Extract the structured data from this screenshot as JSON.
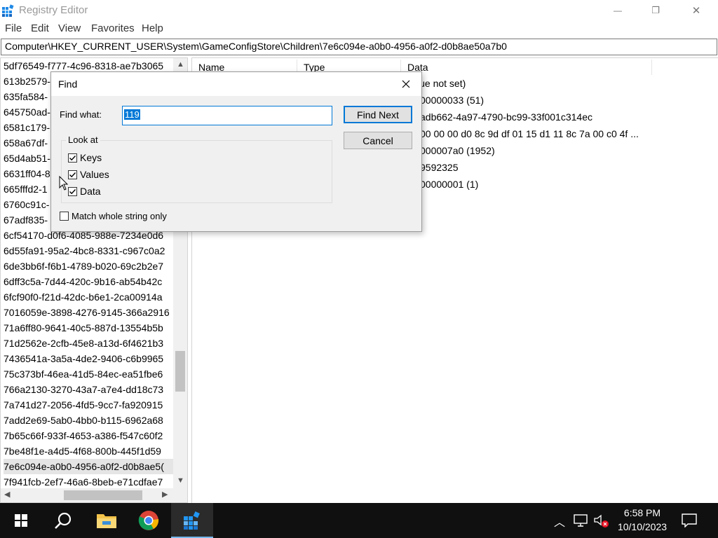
{
  "window": {
    "title": "Registry Editor",
    "minimize_glyph": "—",
    "restore_glyph": "❐",
    "close_glyph": "✕"
  },
  "menu": [
    "File",
    "Edit",
    "View",
    "Favorites",
    "Help"
  ],
  "address": "Computer\\HKEY_CURRENT_USER\\System\\GameConfigStore\\Children\\7e6c094e-a0b0-4956-a0f2-d0b8ae50a7b0",
  "tree": {
    "items": [
      "5df76549-f777-4c96-8318-ae7b3065",
      "613b2579-",
      "635fa584-",
      "645750ad-",
      "6581c179-",
      "658a67df-",
      "65d4ab51-",
      "6631ff04-8",
      "665fffd2-1",
      "6760c91c-",
      "67adf835-",
      "6cf54170-d0f6-4085-988e-7234e0d6",
      "6d55fa91-95a2-4bc8-8331-c967c0a2",
      "6de3bb6f-f6b1-4789-b020-69c2b2e7",
      "6dff3c5a-7d44-420c-9b16-ab54b42c",
      "6fcf90f0-f21d-42dc-b6e1-2ca00914a",
      "7016059e-3898-4276-9145-366a2916",
      "71a6ff80-9641-40c5-887d-13554b5b",
      "71d2562e-2cfb-45e8-a13d-6f4621b3",
      "7436541a-3a5a-4de2-9406-c6b9965",
      "75c373bf-46ea-41d5-84ec-ea51fbe6",
      "766a2130-3270-43a7-a7e4-dd18c73",
      "7a741d27-2056-4fd5-9cc7-fa920915",
      "7add2e69-5ab0-4bb0-b115-6962a68",
      "7b65c66f-933f-4653-a386-f547c60f2",
      "7be48f1e-a4d5-4f68-800b-445f1d59",
      "7e6c094e-a0b0-4956-a0f2-d0b8ae5(",
      "7f941fcb-2ef7-46a6-8beb-e71cdfae7"
    ],
    "selected_index": 26
  },
  "list": {
    "columns": [
      "Name",
      "Type",
      "Data"
    ],
    "data_values": [
      "lue not set)",
      "00000033 (51)",
      "adb662-4a97-4790-bc99-33f001c314ec",
      "00 00 00 d0 8c 9d df 01 15 d1 11 8c 7a 00 c0 4f ...",
      "000007a0 (1952)",
      "9592325",
      "00000001 (1)"
    ]
  },
  "find_dialog": {
    "title": "Find",
    "find_what_label": "Find what:",
    "find_what_value": "119",
    "find_next_label": "Find Next",
    "cancel_label": "Cancel",
    "look_at_label": "Look at",
    "keys_label": "Keys",
    "keys_checked": true,
    "values_label": "Values",
    "values_checked": true,
    "data_label": "Data",
    "data_checked": true,
    "match_whole_label": "Match whole string only",
    "match_whole_checked": false
  },
  "taskbar": {
    "time": "6:58 PM",
    "date": "10/10/2023",
    "accent": "#76b9ed"
  }
}
